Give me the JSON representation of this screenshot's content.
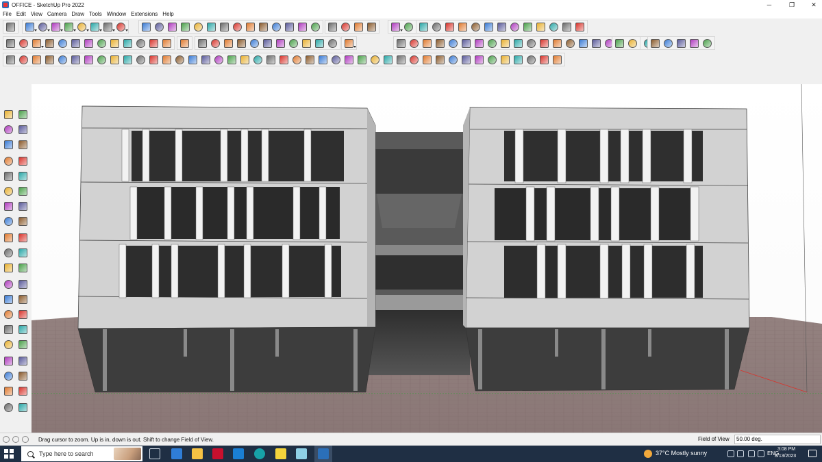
{
  "window": {
    "title": "OFFICE - SketchUp Pro 2022",
    "controls": {
      "minimize": "─",
      "maximize": "❐",
      "close": "✕"
    }
  },
  "menu": [
    "File",
    "Edit",
    "View",
    "Camera",
    "Draw",
    "Tools",
    "Window",
    "Extensions",
    "Help"
  ],
  "status": {
    "message": "Drag cursor to zoom.  Up is in, down is out. Shift to change Field of View.",
    "field_label": "Field of View",
    "field_value": "50.00 deg."
  },
  "taskbar": {
    "search_placeholder": "Type here to search",
    "weather": "37°C  Mostly sunny",
    "language": "ENG",
    "time": "3:08 PM",
    "date": "8/13/2023"
  },
  "colors": {
    "ground": "#8f7c7c",
    "facade": "#d3d3d3",
    "glass": "#4a4a4a",
    "accent_red": "#d8342c",
    "toolbar_bg": "#f0f0f0",
    "taskbar": "#1f2f44"
  }
}
